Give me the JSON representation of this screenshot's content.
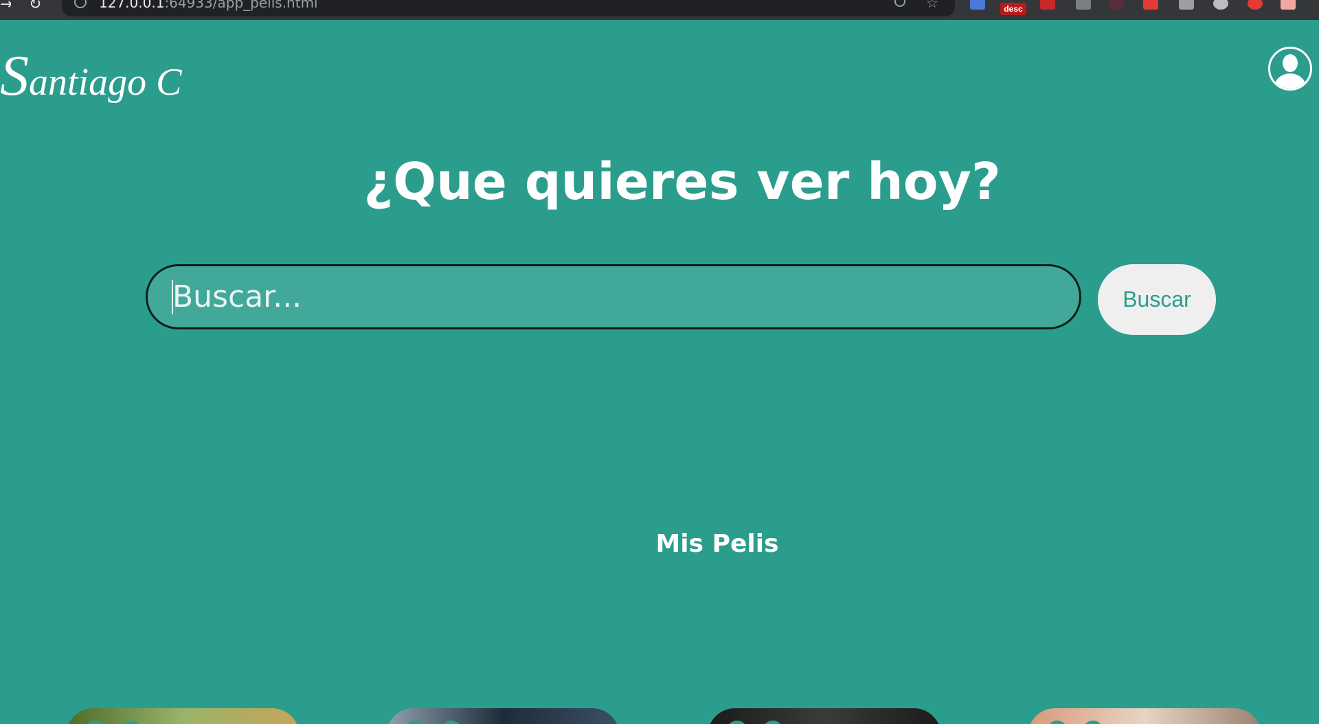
{
  "browser": {
    "url_host": "127.0.0.1",
    "url_rest": ":64933/app_pelis.html",
    "extensions": [
      "translate-icon",
      "desc",
      "pdf-icon",
      "puzzle-icon",
      "k-icon",
      "adblock-icon",
      "shield-icon",
      "gear-icon",
      "pin-icon",
      "photo-icon"
    ],
    "ext_desc_label": "desc"
  },
  "header": {
    "logo_cap": "S",
    "logo_rest": "antiago C"
  },
  "main": {
    "headline": "¿Que quieres ver hoy?",
    "search": {
      "placeholder": "Buscar...",
      "value": ""
    },
    "search_button_label": "Buscar",
    "section_title": "Mis Pelis"
  },
  "posters": [
    {
      "name": "movie-poster-1",
      "color": "#6b8a3a"
    },
    {
      "name": "movie-poster-2",
      "color": "#27384a"
    },
    {
      "name": "movie-poster-3",
      "color": "#2a2a2a"
    },
    {
      "name": "movie-poster-4",
      "color": "#c9a78a"
    }
  ],
  "colors": {
    "background": "#2b9d8d",
    "input_fill": "#42a89a",
    "button_fill": "#efefef",
    "button_text": "#2b9d8d"
  }
}
